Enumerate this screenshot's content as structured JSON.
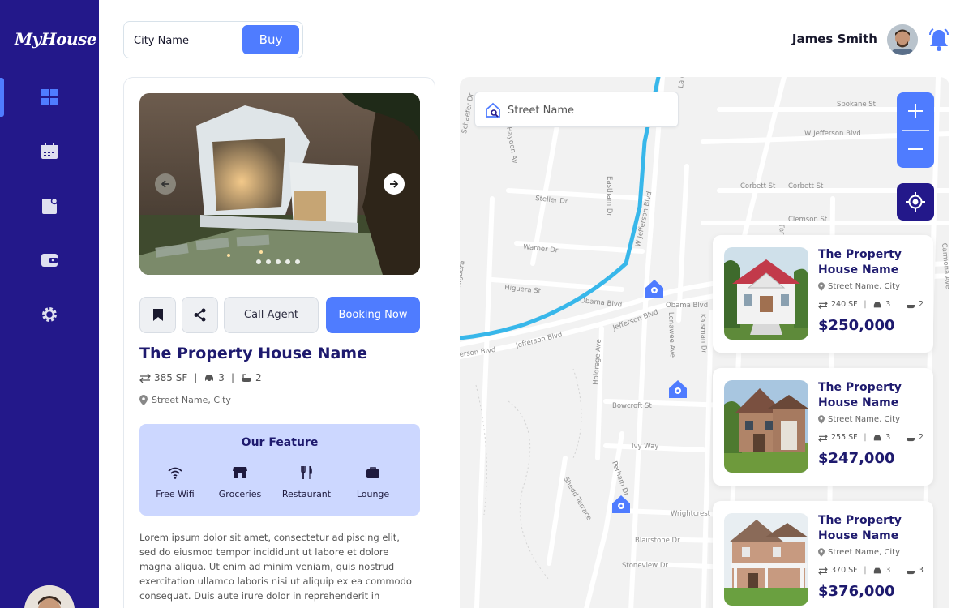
{
  "brand": {
    "logo_text": "MyHouse"
  },
  "sidebar": {
    "items": [
      {
        "icon": "dashboard-grid-icon"
      },
      {
        "icon": "calendar-icon"
      },
      {
        "icon": "notes-icon"
      },
      {
        "icon": "wallet-icon"
      },
      {
        "icon": "gear-icon"
      }
    ],
    "active_index": 0
  },
  "search": {
    "placeholder": "City Name",
    "button_label": "Buy"
  },
  "user": {
    "name": "James Smith"
  },
  "detail": {
    "carousel_dots": 5,
    "actions": {
      "call_label": "Call Agent",
      "booking_label": "Booking Now"
    },
    "title": "The Property House Name",
    "specs": {
      "area": "385 SF",
      "cars": "3",
      "baths": "2"
    },
    "address": "Street Name, City",
    "features": {
      "title": "Our Feature",
      "items": [
        {
          "label": "Free Wifi",
          "icon": "wifi-icon"
        },
        {
          "label": "Groceries",
          "icon": "store-icon"
        },
        {
          "label": "Restaurant",
          "icon": "utensils-icon"
        },
        {
          "label": "Lounge",
          "icon": "briefcase-icon"
        }
      ]
    },
    "description": "Lorem ipsum dolor sit amet, consectetur adipiscing elit, sed do eiusmod tempor incididunt ut labore et dolore magna aliqua. Ut enim ad minim veniam, quis nostrud exercitation ullamco laboris nisi ut aliquip ex ea commodo consequat. Duis aute irure dolor in reprehenderit in"
  },
  "map": {
    "search_placeholder": "Street Name",
    "streets": [
      "Spokane St",
      "W Jefferson Blvd",
      "Corbett St",
      "Corbett St",
      "Clemson St",
      "Steller Dr",
      "Warner Dr",
      "Higuera St",
      "Obama Blvd",
      "Obama Blvd",
      "Jefferson Blvd",
      "Jefferson Blvd",
      "erson Blvd",
      "Bowcroft St",
      "Ivy Way",
      "Wrightcrest",
      "Blairstone Dr",
      "Stoneview Dr",
      "W Jefferson Blvd",
      "Eastham Dr",
      "Hayden Av",
      "Schaefer Dr",
      "Lenawee Ave",
      "Kalsman Dr",
      "Holdrege Ave",
      "Farmdale Ave",
      "Carmona Ave",
      "Perham Dr",
      "Shedd Terrace",
      "La Cienega",
      "Higuera"
    ]
  },
  "listings": [
    {
      "title": "The Property House Name",
      "address": "Street Name, City",
      "area": "240 SF",
      "cars": "3",
      "baths": "2",
      "price": "$250,000"
    },
    {
      "title": "The Property House Name",
      "address": "Street Name, City",
      "area": "255 SF",
      "cars": "3",
      "baths": "2",
      "price": "$247,000"
    },
    {
      "title": "The Property House Name",
      "address": "Street Name, City",
      "area": "370 SF",
      "cars": "3",
      "baths": "3",
      "price": "$376,000"
    }
  ],
  "colors": {
    "sidebar": "#23188a",
    "accent": "#4f7cff",
    "title": "#1e1a6e",
    "feature_bg": "#ccd7ff",
    "route": "#38b7ea"
  }
}
